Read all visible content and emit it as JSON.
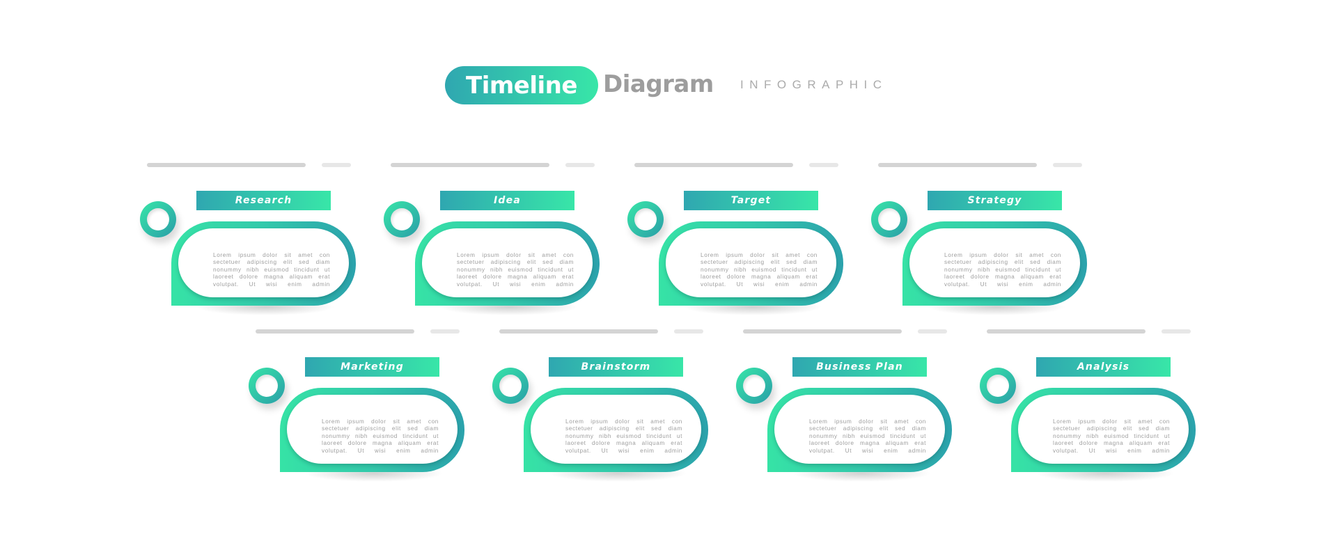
{
  "header": {
    "title_highlight": "Timeline",
    "title_rest": "Diagram",
    "tagline": "INFOGRAPHIC"
  },
  "colors": {
    "gradient_start": "#2fa7b0",
    "gradient_end": "#38e6a8",
    "bar_primary": "#d4d4d4",
    "bar_secondary": "#e7e7e7",
    "body_text": "#9e9e9e",
    "title_gray": "#9d9d9d"
  },
  "steps": [
    {
      "label": "Research",
      "text": "Lorem ipsum dolor sit amet con sectetuer adipiscing elit sed diam nonummy nibh euismod tincidunt ut laoreet dolore magna aliquam erat volutpat. Ut wisi enim admin"
    },
    {
      "label": "Idea",
      "text": "Lorem ipsum dolor sit amet con sectetuer adipiscing elit sed diam nonummy nibh euismod tincidunt ut laoreet dolore magna aliquam erat volutpat. Ut wisi enim admin"
    },
    {
      "label": "Target",
      "text": "Lorem ipsum dolor sit amet con sectetuer adipiscing elit sed diam nonummy nibh euismod tincidunt ut laoreet dolore magna aliquam erat volutpat. Ut wisi enim admin"
    },
    {
      "label": "Strategy",
      "text": "Lorem ipsum dolor sit amet con sectetuer adipiscing elit sed diam nonummy nibh euismod tincidunt ut laoreet dolore magna aliquam erat volutpat. Ut wisi enim admin"
    },
    {
      "label": "Marketing",
      "text": "Lorem ipsum dolor sit amet con sectetuer adipiscing elit sed diam nonummy nibh euismod tincidunt ut laoreet dolore magna aliquam erat volutpat. Ut wisi enim admin"
    },
    {
      "label": "Brainstorm",
      "text": "Lorem ipsum dolor sit amet con sectetuer adipiscing elit sed diam nonummy nibh euismod tincidunt ut laoreet dolore magna aliquam erat volutpat. Ut wisi enim admin"
    },
    {
      "label": "Business Plan",
      "text": "Lorem ipsum dolor sit amet con sectetuer adipiscing elit sed diam nonummy nibh euismod tincidunt ut laoreet dolore magna aliquam erat volutpat. Ut wisi enim admin"
    },
    {
      "label": "Analysis",
      "text": "Lorem ipsum dolor sit amet con sectetuer adipiscing elit sed diam nonummy nibh euismod tincidunt ut laoreet dolore magna aliquam erat volutpat. Ut wisi enim admin"
    }
  ]
}
